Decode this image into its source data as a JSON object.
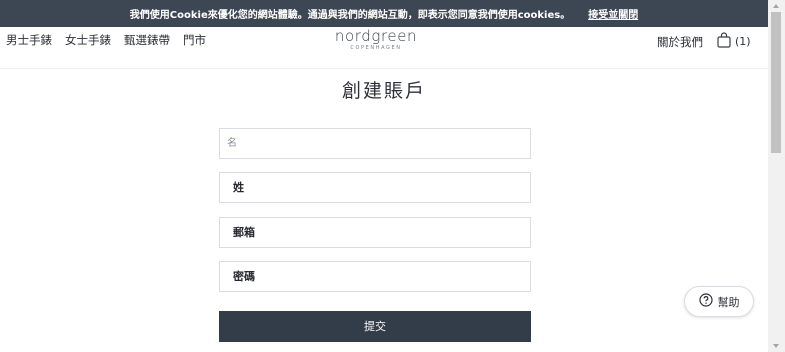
{
  "cookie_bar": {
    "message": "我們使用Cookie來優化您的網站體驗。通過與我們的網站互動，即表示您同意我們使用cookies。",
    "accept_label": "接受並關閉"
  },
  "nav": {
    "items": [
      "男士手錶",
      "女士手錶",
      "甄選錶帶",
      "門市"
    ],
    "about": "關於我們",
    "cart_count": "(1)"
  },
  "logo": {
    "brand": "nordgreen",
    "subtitle": "COPENHAGEN"
  },
  "page": {
    "title": "創建賬戶"
  },
  "form": {
    "first_name_placeholder": "名",
    "last_name_value": "姓",
    "email_value": "郵箱",
    "password_value": "密碼",
    "submit_label": "提交"
  },
  "help": {
    "label": "幫助"
  },
  "colors": {
    "dark": "#333d49",
    "cookie_bar": "#3d4753"
  }
}
